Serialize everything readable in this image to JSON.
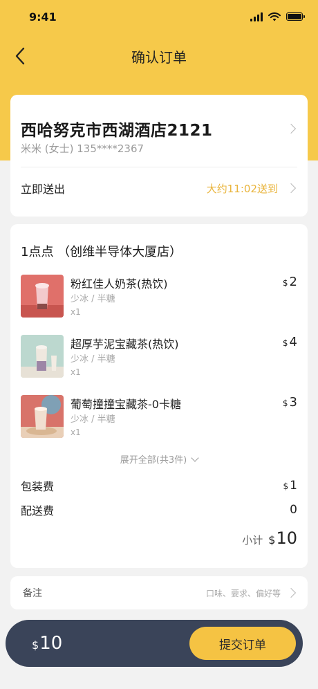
{
  "status_bar": {
    "time": "9:41"
  },
  "nav": {
    "title": "确认订单"
  },
  "address": {
    "title": "西哈努克市西湖酒店2121",
    "contact": "米米 (女士) 135****2367",
    "delivery_label": "立即送出",
    "delivery_time": "大约11:02送到"
  },
  "order": {
    "shop_name": "1点点 （创维半导体大厦店）",
    "currency_symbol": "$",
    "items": [
      {
        "name": "粉红佳人奶茶(热饮)",
        "spec": "少冰 / 半糖",
        "qty": "x1",
        "price": "2"
      },
      {
        "name": "超厚芋泥宝藏茶(热饮)",
        "spec": "少冰 / 半糖",
        "qty": "x1",
        "price": "4"
      },
      {
        "name": "葡萄撞撞宝藏茶-0卡糖",
        "spec": "少冰 / 半糖",
        "qty": "x1",
        "price": "3"
      }
    ],
    "expand_label": "展开全部(共3件)",
    "packaging_label": "包装费",
    "packaging_fee": "1",
    "delivery_fee_label": "配送费",
    "delivery_fee": "0",
    "subtotal_label": "小计",
    "subtotal": "10"
  },
  "note": {
    "label": "备注",
    "hint": "口味、要求、偏好等"
  },
  "footer": {
    "currency_symbol": "$",
    "total": "10",
    "submit_label": "提交订单"
  },
  "colors": {
    "brand_yellow": "#f6c94a",
    "accent_text": "#e9b43c",
    "bottom_bar": "#3a4459"
  }
}
